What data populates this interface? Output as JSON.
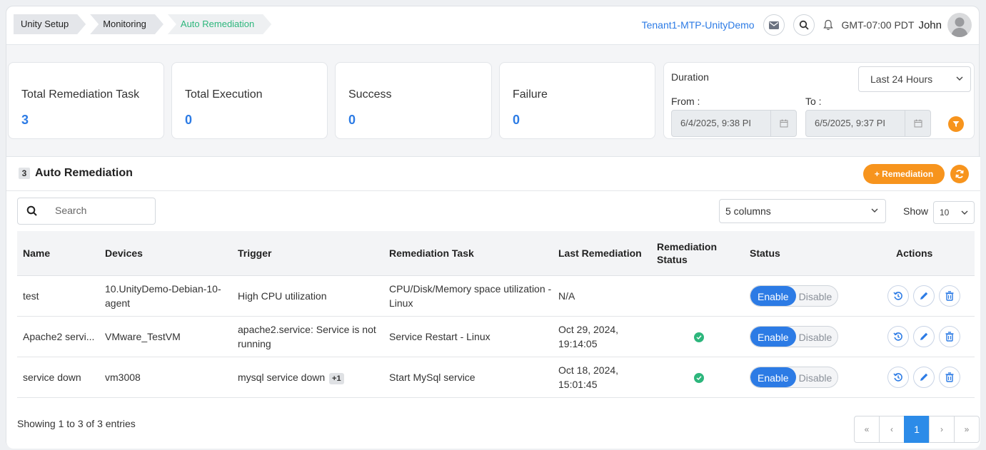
{
  "breadcrumbs": [
    "Unity Setup",
    "Monitoring",
    "Auto Remediation"
  ],
  "header": {
    "tenant": "Tenant1-MTP-UnityDemo",
    "timezone": "GMT-07:00 PDT",
    "user": "John",
    "icons": [
      "mail-icon",
      "search-icon",
      "bell-icon",
      "avatar-icon"
    ]
  },
  "stats": [
    {
      "label": "Total Remediation Task",
      "value": "3"
    },
    {
      "label": "Total Execution",
      "value": "0"
    },
    {
      "label": "Success",
      "value": "0"
    },
    {
      "label": "Failure",
      "value": "0"
    }
  ],
  "duration": {
    "label": "Duration",
    "selected": "Last 24 Hours",
    "from_label": "From :",
    "from_value": "6/4/2025, 9:38 PI",
    "to_label": "To :",
    "to_value": "6/5/2025, 9:37 PI"
  },
  "panel": {
    "count": "3",
    "title": "Auto Remediation",
    "add_label": "+ Remediation",
    "search_placeholder": "Search",
    "columns_selected": "5 columns",
    "show_label": "Show",
    "show_value": "10"
  },
  "table": {
    "headers": [
      "Name",
      "Devices",
      "Trigger",
      "Remediation Task",
      "Last Remediation",
      "Remediation Status",
      "Status",
      "Actions"
    ],
    "rows": [
      {
        "name": "test",
        "device": "10.UnityDemo-Debian-10-agent",
        "trigger": "High CPU utilization",
        "trigger_extra": "",
        "task": "CPU/Disk/Memory space utilization - Linux",
        "last": "N/A",
        "status_ok": false,
        "enable": "Enable",
        "disable": "Disable"
      },
      {
        "name": "Apache2 servi...",
        "device": "VMware_TestVM",
        "trigger": "apache2.service: Service is not running",
        "trigger_extra": "",
        "task": "Service Restart - Linux",
        "last": "Oct 29, 2024, 19:14:05",
        "status_ok": true,
        "enable": "Enable",
        "disable": "Disable"
      },
      {
        "name": "service down",
        "device": "vm3008",
        "trigger": "mysql service down",
        "trigger_extra": "+1",
        "task": "Start MySql service",
        "last": "Oct 18, 2024, 15:01:45",
        "status_ok": true,
        "enable": "Enable",
        "disable": "Disable"
      }
    ]
  },
  "footer": {
    "info": "Showing 1 to 3 of 3 entries",
    "pages": [
      "«",
      "‹",
      "1",
      "›",
      "»"
    ],
    "current_page": "1"
  },
  "colors": {
    "accent": "#2c7be5",
    "orange": "#f7941d",
    "success": "#2db67c"
  }
}
